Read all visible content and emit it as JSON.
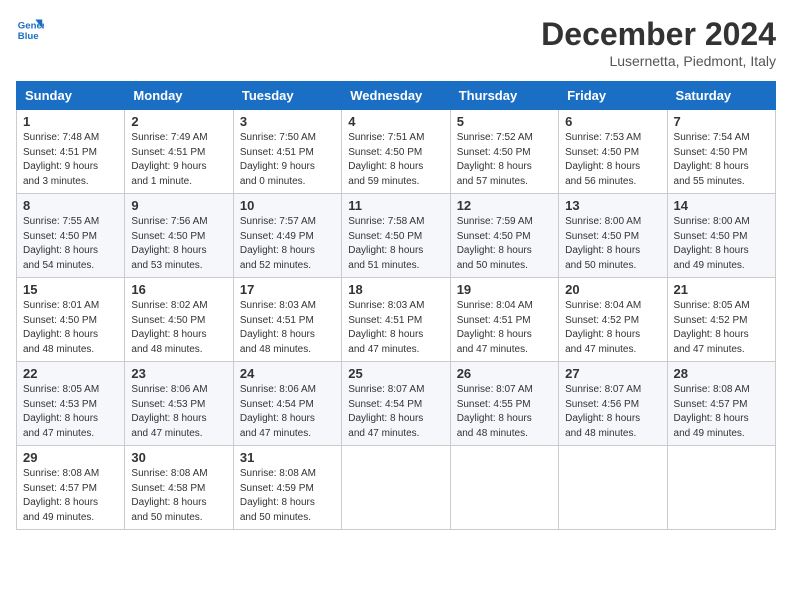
{
  "logo": {
    "line1": "General",
    "line2": "Blue"
  },
  "title": "December 2024",
  "location": "Lusernetta, Piedmont, Italy",
  "headers": [
    "Sunday",
    "Monday",
    "Tuesday",
    "Wednesday",
    "Thursday",
    "Friday",
    "Saturday"
  ],
  "weeks": [
    [
      {
        "day": "1",
        "info": "Sunrise: 7:48 AM\nSunset: 4:51 PM\nDaylight: 9 hours\nand 3 minutes."
      },
      {
        "day": "2",
        "info": "Sunrise: 7:49 AM\nSunset: 4:51 PM\nDaylight: 9 hours\nand 1 minute."
      },
      {
        "day": "3",
        "info": "Sunrise: 7:50 AM\nSunset: 4:51 PM\nDaylight: 9 hours\nand 0 minutes."
      },
      {
        "day": "4",
        "info": "Sunrise: 7:51 AM\nSunset: 4:50 PM\nDaylight: 8 hours\nand 59 minutes."
      },
      {
        "day": "5",
        "info": "Sunrise: 7:52 AM\nSunset: 4:50 PM\nDaylight: 8 hours\nand 57 minutes."
      },
      {
        "day": "6",
        "info": "Sunrise: 7:53 AM\nSunset: 4:50 PM\nDaylight: 8 hours\nand 56 minutes."
      },
      {
        "day": "7",
        "info": "Sunrise: 7:54 AM\nSunset: 4:50 PM\nDaylight: 8 hours\nand 55 minutes."
      }
    ],
    [
      {
        "day": "8",
        "info": "Sunrise: 7:55 AM\nSunset: 4:50 PM\nDaylight: 8 hours\nand 54 minutes."
      },
      {
        "day": "9",
        "info": "Sunrise: 7:56 AM\nSunset: 4:50 PM\nDaylight: 8 hours\nand 53 minutes."
      },
      {
        "day": "10",
        "info": "Sunrise: 7:57 AM\nSunset: 4:49 PM\nDaylight: 8 hours\nand 52 minutes."
      },
      {
        "day": "11",
        "info": "Sunrise: 7:58 AM\nSunset: 4:50 PM\nDaylight: 8 hours\nand 51 minutes."
      },
      {
        "day": "12",
        "info": "Sunrise: 7:59 AM\nSunset: 4:50 PM\nDaylight: 8 hours\nand 50 minutes."
      },
      {
        "day": "13",
        "info": "Sunrise: 8:00 AM\nSunset: 4:50 PM\nDaylight: 8 hours\nand 50 minutes."
      },
      {
        "day": "14",
        "info": "Sunrise: 8:00 AM\nSunset: 4:50 PM\nDaylight: 8 hours\nand 49 minutes."
      }
    ],
    [
      {
        "day": "15",
        "info": "Sunrise: 8:01 AM\nSunset: 4:50 PM\nDaylight: 8 hours\nand 48 minutes."
      },
      {
        "day": "16",
        "info": "Sunrise: 8:02 AM\nSunset: 4:50 PM\nDaylight: 8 hours\nand 48 minutes."
      },
      {
        "day": "17",
        "info": "Sunrise: 8:03 AM\nSunset: 4:51 PM\nDaylight: 8 hours\nand 48 minutes."
      },
      {
        "day": "18",
        "info": "Sunrise: 8:03 AM\nSunset: 4:51 PM\nDaylight: 8 hours\nand 47 minutes."
      },
      {
        "day": "19",
        "info": "Sunrise: 8:04 AM\nSunset: 4:51 PM\nDaylight: 8 hours\nand 47 minutes."
      },
      {
        "day": "20",
        "info": "Sunrise: 8:04 AM\nSunset: 4:52 PM\nDaylight: 8 hours\nand 47 minutes."
      },
      {
        "day": "21",
        "info": "Sunrise: 8:05 AM\nSunset: 4:52 PM\nDaylight: 8 hours\nand 47 minutes."
      }
    ],
    [
      {
        "day": "22",
        "info": "Sunrise: 8:05 AM\nSunset: 4:53 PM\nDaylight: 8 hours\nand 47 minutes."
      },
      {
        "day": "23",
        "info": "Sunrise: 8:06 AM\nSunset: 4:53 PM\nDaylight: 8 hours\nand 47 minutes."
      },
      {
        "day": "24",
        "info": "Sunrise: 8:06 AM\nSunset: 4:54 PM\nDaylight: 8 hours\nand 47 minutes."
      },
      {
        "day": "25",
        "info": "Sunrise: 8:07 AM\nSunset: 4:54 PM\nDaylight: 8 hours\nand 47 minutes."
      },
      {
        "day": "26",
        "info": "Sunrise: 8:07 AM\nSunset: 4:55 PM\nDaylight: 8 hours\nand 48 minutes."
      },
      {
        "day": "27",
        "info": "Sunrise: 8:07 AM\nSunset: 4:56 PM\nDaylight: 8 hours\nand 48 minutes."
      },
      {
        "day": "28",
        "info": "Sunrise: 8:08 AM\nSunset: 4:57 PM\nDaylight: 8 hours\nand 49 minutes."
      }
    ],
    [
      {
        "day": "29",
        "info": "Sunrise: 8:08 AM\nSunset: 4:57 PM\nDaylight: 8 hours\nand 49 minutes."
      },
      {
        "day": "30",
        "info": "Sunrise: 8:08 AM\nSunset: 4:58 PM\nDaylight: 8 hours\nand 50 minutes."
      },
      {
        "day": "31",
        "info": "Sunrise: 8:08 AM\nSunset: 4:59 PM\nDaylight: 8 hours\nand 50 minutes."
      },
      null,
      null,
      null,
      null
    ]
  ]
}
